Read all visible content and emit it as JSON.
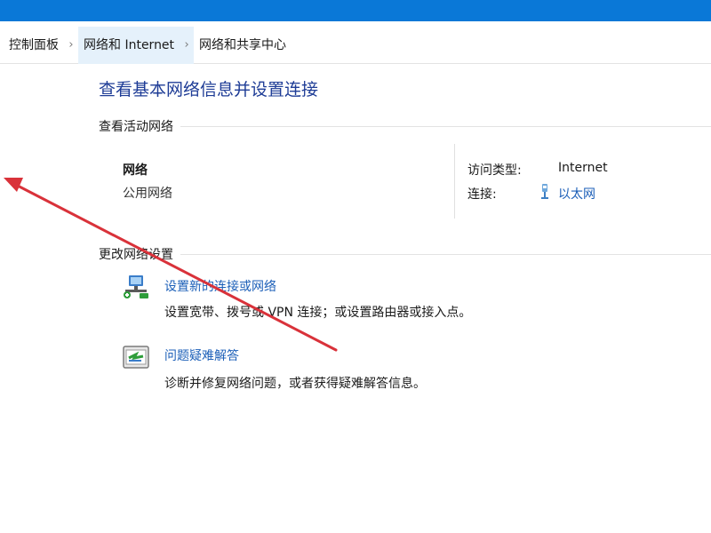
{
  "breadcrumb": {
    "items": [
      "控制面板",
      "网络和 Internet",
      "网络和共享中心"
    ],
    "separator": "›"
  },
  "main": {
    "title": "查看基本网络信息并设置连接",
    "active_networks": {
      "heading": "查看活动网络",
      "network_name": "网络",
      "network_type": "公用网络",
      "access_type_label": "访问类型:",
      "access_type_value": "Internet",
      "connections_label": "连接:",
      "connections_value": "以太网"
    },
    "change_settings": {
      "heading": "更改网络设置",
      "tasks": [
        {
          "link": "设置新的连接或网络",
          "description": "设置宽带、拨号或 VPN 连接；或设置路由器或接入点。",
          "icon": "network-setup-icon"
        },
        {
          "link": "问题疑难解答",
          "description": "诊断并修复网络问题，或者获得疑难解答信息。",
          "icon": "troubleshoot-icon"
        }
      ]
    }
  },
  "colors": {
    "title_bar": "#0a78d7",
    "heading": "#1e3c96",
    "link": "#1c5fb8",
    "annotation_arrow": "#d9323a"
  },
  "annotation": {
    "icon": "red-arrow-annotation"
  }
}
